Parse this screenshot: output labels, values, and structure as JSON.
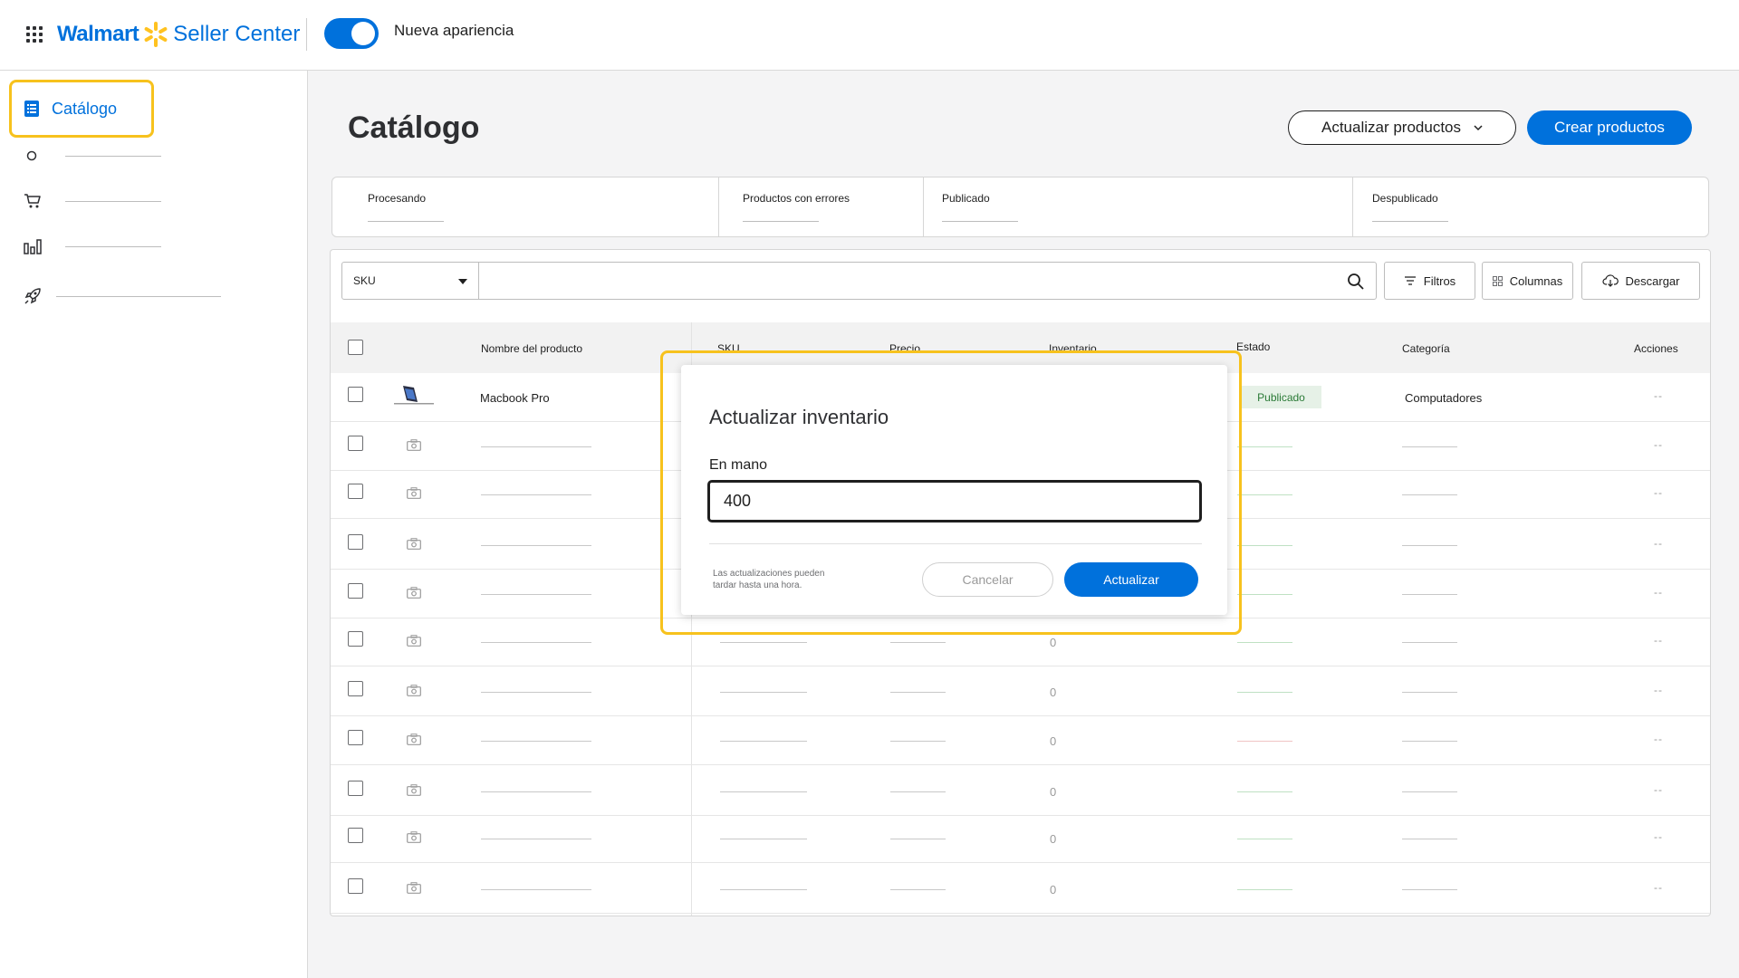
{
  "header": {
    "brand_walmart": "Walmart",
    "brand_seller_center": "Seller Center",
    "toggle_label": "Nueva apariencia",
    "toggle_on": true
  },
  "sidebar": {
    "active_item": "Catálogo",
    "icons": [
      "circle-icon",
      "cart-icon",
      "bar-chart-icon",
      "rocket-icon"
    ]
  },
  "main": {
    "title": "Catálogo",
    "update_products_label": "Actualizar productos",
    "create_products_label": "Crear productos"
  },
  "status_tabs": [
    "Procesando",
    "Productos con errores",
    "Publicado",
    "Despublicado"
  ],
  "toolbar": {
    "search_by": "SKU",
    "search_value": "",
    "filters_label": "Filtros",
    "columns_label": "Columnas",
    "download_label": "Descargar"
  },
  "table": {
    "columns": [
      "Nombre del producto",
      "SKU",
      "Precio",
      "Inventario",
      "Estado",
      "Categoría",
      "Acciones"
    ],
    "first_row": {
      "name": "Macbook Pro",
      "status": "Publicado",
      "category": "Computadores",
      "actions": "--"
    },
    "placeholder_inventory": "0",
    "placeholder_actions": "--"
  },
  "modal": {
    "title": "Actualizar inventario",
    "field_label": "En mano",
    "field_value": "400",
    "note": "Las actualizaciones pueden tardar hasta una hora.",
    "cancel_label": "Cancelar",
    "update_label": "Actualizar"
  },
  "colors": {
    "brand_blue": "#0071dc",
    "spark_yellow": "#ffc220",
    "highlight_yellow": "#f7c21d",
    "published_green": "#2a7a36"
  }
}
